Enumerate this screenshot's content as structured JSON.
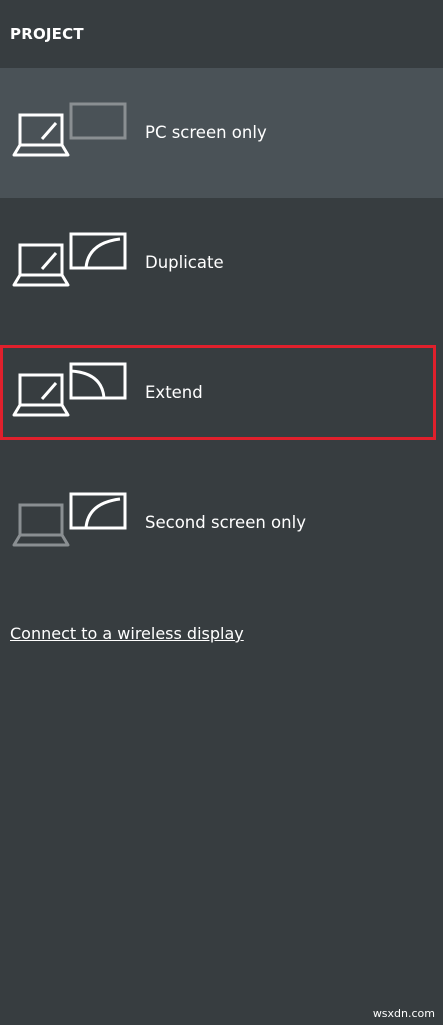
{
  "panel": {
    "title": "PROJECT"
  },
  "options": [
    {
      "label": "PC screen only",
      "selected": true
    },
    {
      "label": "Duplicate",
      "selected": false
    },
    {
      "label": "Extend",
      "selected": false,
      "highlighted": true
    },
    {
      "label": "Second screen only",
      "selected": false
    }
  ],
  "link": {
    "label": "Connect to a wireless display"
  },
  "footer": {
    "watermark": "wsxdn.com"
  },
  "colors": {
    "background": "#373d40",
    "selected_background": "#4a5257",
    "highlight_border": "#e0202c",
    "icon_active": "#ffffff",
    "icon_dim": "#8a8f92"
  }
}
